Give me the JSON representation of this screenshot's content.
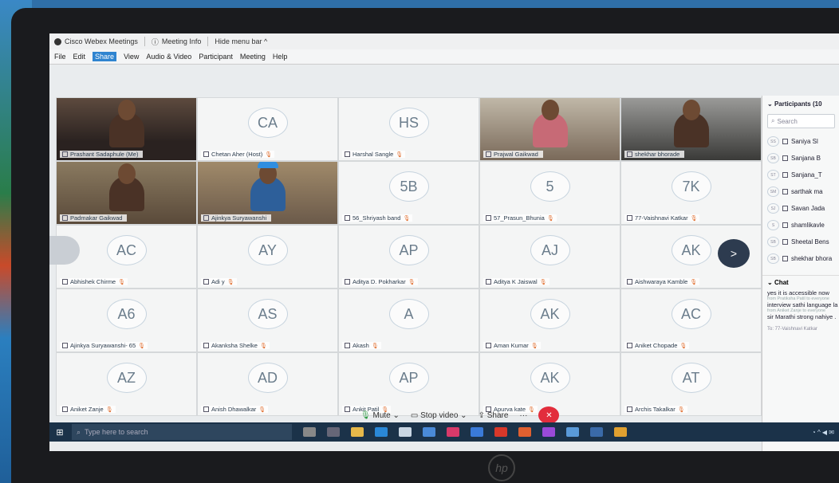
{
  "window": {
    "app_title": "Cisco Webex Meetings",
    "meeting_info": "Meeting Info",
    "hide_menu": "Hide menu bar ^"
  },
  "menu": [
    "File",
    "Edit",
    "Share",
    "View",
    "Audio & Video",
    "Participant",
    "Meeting",
    "Help"
  ],
  "tiles": [
    {
      "name": "Prashant Sadaphule (Me)",
      "initials": "",
      "video": "p1"
    },
    {
      "name": "Chetan Aher (Host)",
      "initials": "CA"
    },
    {
      "name": "Harshal Sangle",
      "initials": "HS"
    },
    {
      "name": "Prajwal Gaikwad",
      "initials": "",
      "video": "p4"
    },
    {
      "name": "shekhar bhorade",
      "initials": "",
      "video": "p5"
    },
    {
      "name": "Padmakar Gaikwad",
      "initials": "",
      "video": "p2"
    },
    {
      "name": "Ajinkya Suryawanshi",
      "initials": "",
      "video": "p3"
    },
    {
      "name": "56_Shriyash band",
      "initials": "5B"
    },
    {
      "name": "57_Prasun_Bhunia",
      "initials": "5"
    },
    {
      "name": "77-Vaishnavi Katkar",
      "initials": "7K"
    },
    {
      "name": "Abhishek Chirme",
      "initials": "AC"
    },
    {
      "name": "Adi y",
      "initials": "AY"
    },
    {
      "name": "Aditya D. Pokharkar",
      "initials": "AP"
    },
    {
      "name": "Aditya K Jaiswal",
      "initials": "AJ"
    },
    {
      "name": "Aishwaraya Kamble",
      "initials": "AK"
    },
    {
      "name": "Ajinkya Suryawanshi- 65",
      "initials": "A6"
    },
    {
      "name": "Akanksha Shelke",
      "initials": "AS"
    },
    {
      "name": "Akash",
      "initials": "A"
    },
    {
      "name": "Aman Kumar",
      "initials": "AK"
    },
    {
      "name": "Aniket Chopade",
      "initials": "AC"
    },
    {
      "name": "Aniket Zanje",
      "initials": "AZ"
    },
    {
      "name": "Anish Dhawalkar",
      "initials": "AD"
    },
    {
      "name": "Ankit Patil",
      "initials": "AP"
    },
    {
      "name": "Apurva kate",
      "initials": "AK"
    },
    {
      "name": "Archis Takalkar",
      "initials": "AT"
    }
  ],
  "panel": {
    "title": "Participants (10",
    "search": "Search",
    "participants": [
      {
        "av": "SS",
        "name": "Saniya Sl"
      },
      {
        "av": "SB",
        "name": "Sanjana B"
      },
      {
        "av": "ST",
        "name": "Sanjana_T"
      },
      {
        "av": "SM",
        "name": "sarthak ma"
      },
      {
        "av": "SJ",
        "name": "Savan Jada"
      },
      {
        "av": "S",
        "name": "shamlikavle"
      },
      {
        "av": "SB",
        "name": "Sheetal Bens"
      },
      {
        "av": "SB",
        "name": "shekhar bhora"
      }
    ],
    "chat_title": "Chat",
    "chat": [
      {
        "text": "yes it is accessible now"
      },
      {
        "meta": "from Pratiksha Patil to everyone"
      },
      {
        "text": "interview sathi language la"
      },
      {
        "meta": "from Aniket Zanje to everyone"
      },
      {
        "text": "sir Marathi strong nahiye ."
      }
    ],
    "to": "To:  77-Vaishnavi Katkar"
  },
  "controls": {
    "mute": "Mute",
    "stop_video": "Stop video",
    "share": "Share",
    "more": "···"
  },
  "taskbar": {
    "search_placeholder": "Type here to search"
  },
  "colors": {
    "accent": "#2f84d0",
    "end_call": "#e22d3c",
    "taskbar": "#1b3249"
  }
}
